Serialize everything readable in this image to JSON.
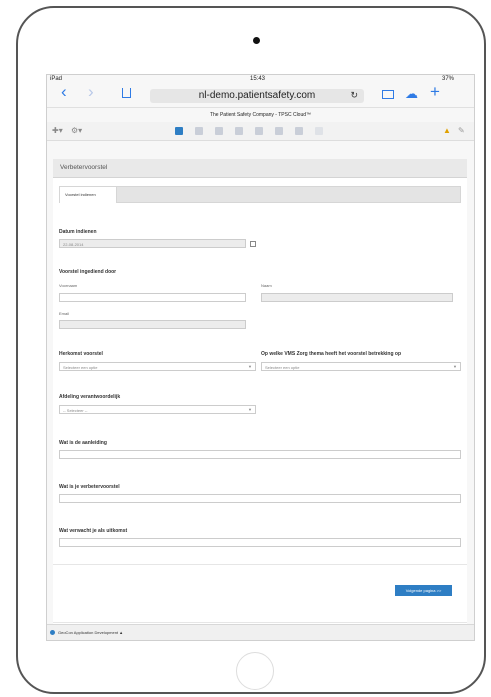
{
  "statusbar": {
    "device": "iPad",
    "time": "15:43",
    "battery": "37%"
  },
  "browser": {
    "url": "nl-demo.patientsafety.com",
    "page_title": "The Patient Safety Company - TPSC Cloud™"
  },
  "header": {
    "title": "Verbetervoorstel"
  },
  "tabs": [
    {
      "label": "Voorstel indienen"
    }
  ],
  "form": {
    "datum_label": "Datum indienen",
    "datum_value": "22-08-2014",
    "ingediend_door_label": "Voorstel ingediend door",
    "voornaam_label": "Voornaam",
    "naam_label": "Naam",
    "email_label": "Email",
    "herkomst_label": "Herkomst voorstel",
    "herkomst_placeholder": "Selecteer een optie",
    "vms_label": "Op welke VMS Zorg thema heeft het voorstel betrekking op",
    "vms_placeholder": "Selecteer een optie",
    "afdeling_label": "Afdeling verantwoordelijk",
    "afdeling_placeholder": "-- Selecteer --",
    "aanleiding_label": "Wat is de aanleiding",
    "voorstel_label": "Wat is je verbetervoorstel",
    "uitkomst_label": "Wat verwacht je als uitkomst",
    "submit_label": "Volgende pagina >>"
  },
  "footer": {
    "text": "GeoCon Application Development ▲"
  },
  "colors": {
    "accent": "#2e7ec4",
    "safari_blue": "#2f7be5"
  }
}
